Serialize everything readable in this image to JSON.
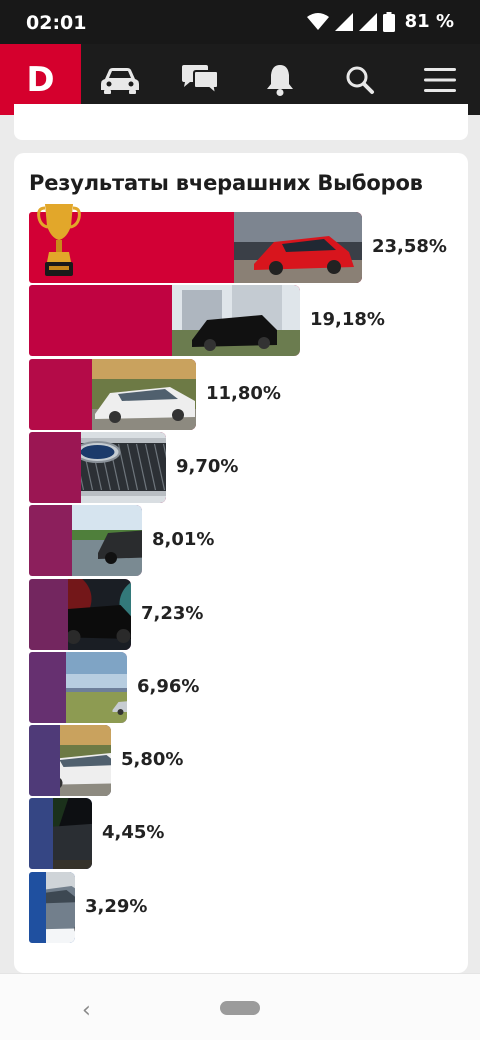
{
  "status": {
    "time": "02:01",
    "battery": "81 %"
  },
  "nav": {
    "logo": "D",
    "icons": [
      "car-icon",
      "chat-icon",
      "bell-icon",
      "search-icon",
      "menu-icon"
    ]
  },
  "card": {
    "title": "Результаты вчерашних Выборов"
  },
  "chart_data": {
    "type": "bar",
    "orientation": "horizontal",
    "title": "Результаты вчерашних Выборов",
    "unit": "%",
    "values": [
      23.58,
      19.18,
      11.8,
      9.7,
      8.01,
      7.23,
      6.96,
      5.8,
      4.45,
      3.29
    ],
    "labels": [
      "23,58%",
      "19,18%",
      "11,80%",
      "9,70%",
      "8,01%",
      "7,23%",
      "6,96%",
      "5,80%",
      "4,45%",
      "3,29%"
    ],
    "colors": [
      "#d20035",
      "#c00341",
      "#b40b48",
      "#9b1653",
      "#8c1f5c",
      "#73265f",
      "#663070",
      "#4f3a78",
      "#354684",
      "#1f50a0"
    ],
    "photos": [
      "red-hatchback-photo",
      "black-sedan-photo",
      "white-sedan-photo",
      "grille-photo",
      "dark-suv-photo",
      "black-suv-photo",
      "landscape-photo",
      "white-sedan-photo",
      "night-car-photo",
      "grey-hatchback-photo"
    ]
  }
}
